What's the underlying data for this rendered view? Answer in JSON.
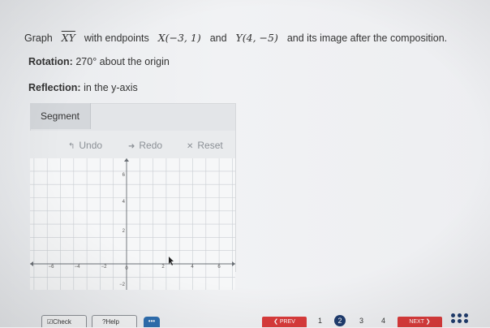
{
  "prompt": {
    "text1": "Graph",
    "segment": "XY",
    "text2": "with endpoints",
    "x_point": "X(−3, 1)",
    "text3": "and",
    "y_point": "Y(4, −5)",
    "text4": "and its image after the composition."
  },
  "rotation": {
    "label": "Rotation:",
    "value": "270° about the origin"
  },
  "reflection": {
    "label": "Reflection:",
    "value": "in the y-axis"
  },
  "tools": {
    "segment_label": "Segment",
    "undo_label": "Undo",
    "redo_label": "Redo",
    "reset_label": "Reset",
    "undo_icon": "undo-arrow-icon",
    "redo_icon": "redo-arrow-icon",
    "reset_icon": "close-icon"
  },
  "graph": {
    "xticks": [
      "−6",
      "−4",
      "−2",
      "0",
      "2",
      "4",
      "6"
    ],
    "yticks": [
      "6",
      "4",
      "2",
      "−2"
    ],
    "cursor_icon": "pointer-icon"
  },
  "nav": {
    "check_label": "Check",
    "help_label": "Help",
    "more_label": "•••",
    "prev_label": "PREV",
    "pages": [
      "1",
      "2",
      "3",
      "4"
    ],
    "current_page": "2",
    "next_label": "NEXT",
    "accent": "#d93b3b",
    "page_color": "#1f3c6e"
  }
}
